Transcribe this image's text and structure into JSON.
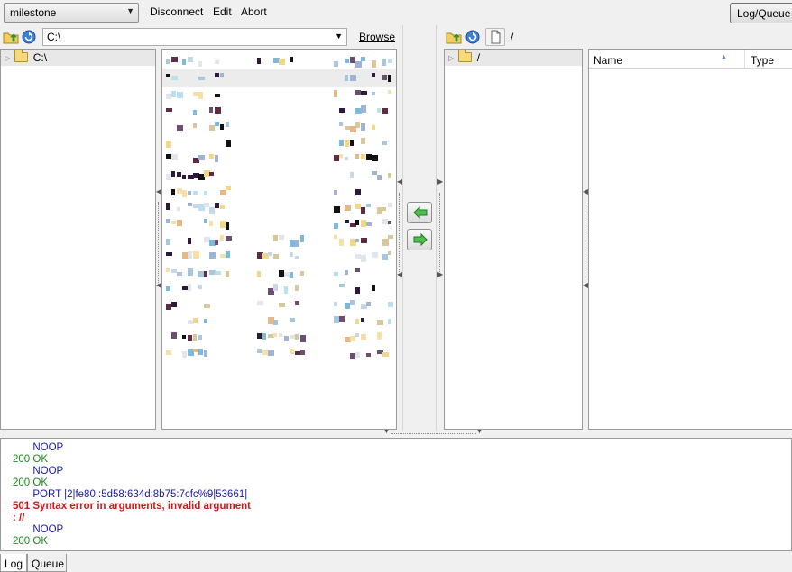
{
  "toolbar": {
    "site": "milestone",
    "menu": [
      {
        "label": "Disconnect"
      },
      {
        "label": "Edit"
      },
      {
        "label": "Abort"
      }
    ],
    "log_queue_button": "Log/Queue"
  },
  "local": {
    "path": "C:\\",
    "browse_label": "Browse",
    "tree_root": "C:\\"
  },
  "remote": {
    "path": "/",
    "tree_root": "/",
    "columns": {
      "name": "Name",
      "type": "Type"
    }
  },
  "log_lines": [
    {
      "text": "       NOOP",
      "kind": "cmd"
    },
    {
      "text": "200 OK",
      "kind": "ok"
    },
    {
      "text": "       NOOP",
      "kind": "cmd"
    },
    {
      "text": "200 OK",
      "kind": "ok"
    },
    {
      "text": "       PORT |2|fe80::5d58:634d:8b75:7cfc%9|53661|",
      "kind": "cmd"
    },
    {
      "text": "501 Syntax error in arguments, invalid argument",
      "kind": "err"
    },
    {
      "text": ": //",
      "kind": "err"
    },
    {
      "text": "       NOOP",
      "kind": "cmd"
    },
    {
      "text": "200 OK",
      "kind": "ok"
    }
  ],
  "tabs": [
    {
      "label": "Log"
    },
    {
      "label": "Queue"
    }
  ],
  "colors": {
    "ok": "#1b8a1b",
    "command": "#1a1aa8",
    "error": "#d01818",
    "folder": "#f5d97b",
    "arrow": "#3aa63a"
  }
}
